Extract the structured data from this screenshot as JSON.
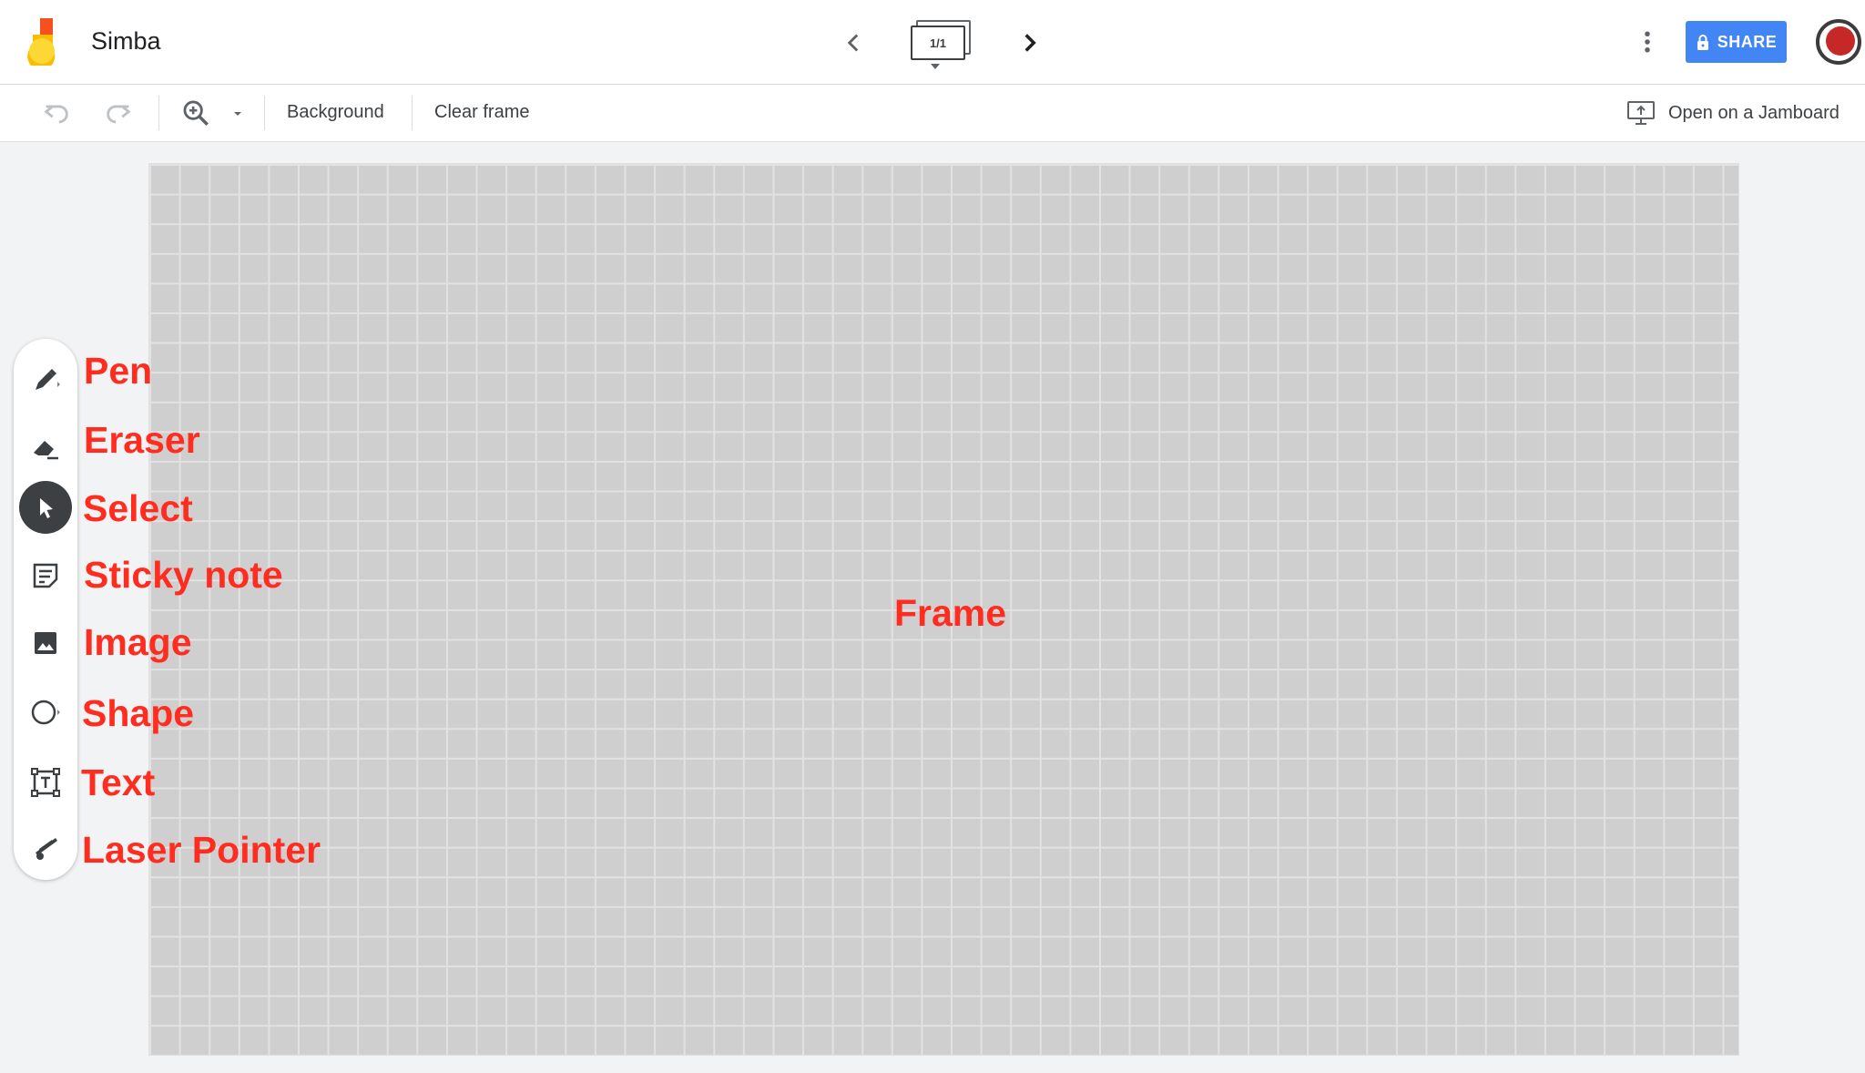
{
  "app": {
    "title": "Simba",
    "logo_icon": "jamboard-logo-icon"
  },
  "header": {
    "frame_counter": "1/1",
    "share_label": "SHARE",
    "share_icon": "lock-icon",
    "share_color": "#4285f4",
    "more_icon": "more-vert-icon",
    "prev_icon": "chevron-left-icon",
    "next_icon": "chevron-right-icon"
  },
  "toolbar": {
    "undo_icon": "undo-icon",
    "redo_icon": "redo-icon",
    "zoom_icon": "zoom-in-icon",
    "background_label": "Background",
    "clear_frame_label": "Clear frame",
    "open_jamboard_label": "Open on a Jamboard",
    "open_jamboard_icon": "cast-to-jamboard-icon"
  },
  "tools": [
    {
      "name": "pen",
      "icon": "pen-icon",
      "label": "Pen",
      "active": false
    },
    {
      "name": "eraser",
      "icon": "eraser-icon",
      "label": "Eraser",
      "active": false
    },
    {
      "name": "select",
      "icon": "cursor-icon",
      "label": "Select",
      "active": true
    },
    {
      "name": "sticky-note",
      "icon": "sticky-note-icon",
      "label": "Sticky note",
      "active": false
    },
    {
      "name": "image",
      "icon": "image-icon",
      "label": "Image",
      "active": false
    },
    {
      "name": "shape",
      "icon": "circle-shape-icon",
      "label": "Shape",
      "active": false
    },
    {
      "name": "text",
      "icon": "text-box-icon",
      "label": "Text",
      "active": false
    },
    {
      "name": "laser-pointer",
      "icon": "laser-pointer-icon",
      "label": "Laser Pointer",
      "active": false
    }
  ],
  "canvas": {
    "annotation": "Frame",
    "annotation_color": "#ff2d20",
    "background_color": "#cfcfcf"
  }
}
